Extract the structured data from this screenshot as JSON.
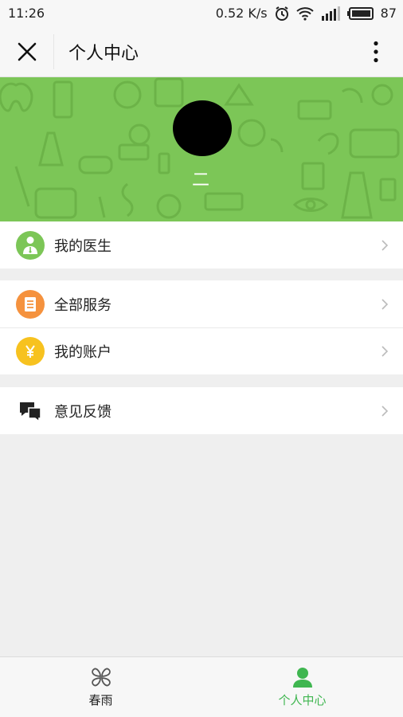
{
  "status_bar": {
    "time": "11:26",
    "network_speed": "0.52 K/s",
    "battery": "87"
  },
  "nav": {
    "title": "个人中心"
  },
  "profile": {
    "username": "二"
  },
  "menu_groups": [
    {
      "items": [
        {
          "label": "我的医生",
          "icon": "doctor-icon",
          "color": "#7cc657"
        }
      ]
    },
    {
      "items": [
        {
          "label": "全部服务",
          "icon": "services-icon",
          "color": "#f5923e"
        },
        {
          "label": "我的账户",
          "icon": "yuan-icon",
          "color": "#f7c21f"
        }
      ]
    },
    {
      "items": [
        {
          "label": "意见反馈",
          "icon": "feedback-icon",
          "color": "#222222"
        }
      ]
    }
  ],
  "tabs": [
    {
      "label": "春雨",
      "icon": "clover-icon",
      "active": false
    },
    {
      "label": "个人中心",
      "icon": "person-icon",
      "active": true
    }
  ],
  "colors": {
    "banner": "#7cc657",
    "active_tab": "#3fb650"
  }
}
